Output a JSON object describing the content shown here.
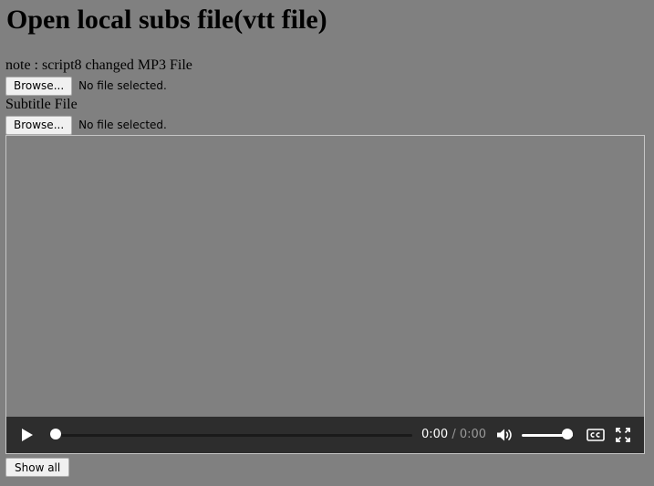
{
  "page": {
    "title": "Open local subs file(vtt file)"
  },
  "media_input": {
    "label": "note : script8 changed MP3 File",
    "browse_label": "Browse...",
    "status": "No file selected."
  },
  "subtitle_input": {
    "label": "Subtitle File",
    "browse_label": "Browse...",
    "status": "No file selected."
  },
  "player": {
    "current_time": "0:00",
    "separator": "/",
    "duration": "0:00",
    "progress": 0,
    "volume": 1.0,
    "icons": [
      "play-icon",
      "volume-icon",
      "closed-captions-icon",
      "fullscreen-icon"
    ]
  },
  "footer": {
    "show_all_label": "Show all"
  },
  "colors": {
    "page_background": "#808080",
    "controls_background": "#1e1e1e",
    "control_foreground": "#ffffff",
    "muted_text": "#9a9a9a"
  }
}
